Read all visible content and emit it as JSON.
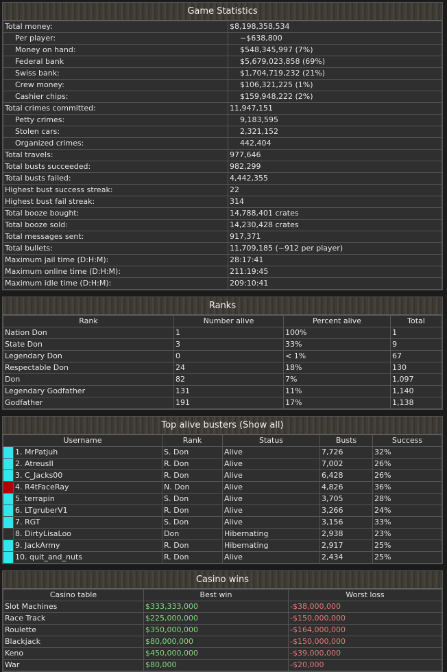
{
  "stats": {
    "title": "Game Statistics",
    "rows": [
      {
        "label": "Total money:",
        "value": "$8,198,358,534",
        "indent": false
      },
      {
        "label": "Per player:",
        "value": "~$638,800",
        "indent": true
      },
      {
        "label": "Money on hand:",
        "value": "$548,345,997 (7%)",
        "indent": true
      },
      {
        "label": "Federal bank",
        "value": "$5,679,023,858 (69%)",
        "indent": true
      },
      {
        "label": "Swiss bank:",
        "value": "$1,704,719,232 (21%)",
        "indent": true
      },
      {
        "label": "Crew money:",
        "value": "$106,321,225 (1%)",
        "indent": true
      },
      {
        "label": "Cashier chips:",
        "value": "$159,948,222 (2%)",
        "indent": true
      },
      {
        "label": "Total crimes committed:",
        "value": "11,947,151",
        "indent": false
      },
      {
        "label": "Petty crimes:",
        "value": "9,183,595",
        "indent": true
      },
      {
        "label": "Stolen cars:",
        "value": "2,321,152",
        "indent": true
      },
      {
        "label": "Organized crimes:",
        "value": "442,404",
        "indent": true
      },
      {
        "label": "Total travels:",
        "value": "977,646",
        "indent": false
      },
      {
        "label": "Total busts succeeded:",
        "value": "982,299",
        "indent": false
      },
      {
        "label": "Total busts failed:",
        "value": "4,442,355",
        "indent": false
      },
      {
        "label": "Highest bust success streak:",
        "value": "22",
        "indent": false
      },
      {
        "label": "Highest bust fail streak:",
        "value": "314",
        "indent": false
      },
      {
        "label": "Total booze bought:",
        "value": "14,788,401 crates",
        "indent": false
      },
      {
        "label": "Total booze sold:",
        "value": "14,230,428 crates",
        "indent": false
      },
      {
        "label": "Total messages sent:",
        "value": "917,371",
        "indent": false
      },
      {
        "label": "Total bullets:",
        "value": "11,709,185 (~912 per player)",
        "indent": false
      },
      {
        "label": "Maximum jail time (D:H:M):",
        "value": "28:17:41",
        "indent": false
      },
      {
        "label": "Maximum online time (D:H:M):",
        "value": "211:19:45",
        "indent": false
      },
      {
        "label": "Maximum idle time (D:H:M):",
        "value": "209:10:41",
        "indent": false
      }
    ]
  },
  "ranks": {
    "title": "Ranks",
    "columns": [
      "Rank",
      "Number alive",
      "Percent alive",
      "Total"
    ],
    "rows": [
      [
        "Nation Don",
        "1",
        "100%",
        "1"
      ],
      [
        "State Don",
        "3",
        "33%",
        "9"
      ],
      [
        "Legendary Don",
        "0",
        "< 1%",
        "67"
      ],
      [
        "Respectable Don",
        "24",
        "18%",
        "130"
      ],
      [
        "Don",
        "82",
        "7%",
        "1,097"
      ],
      [
        "Legendary Godfather",
        "131",
        "11%",
        "1,140"
      ],
      [
        "Godfather",
        "191",
        "17%",
        "1,138"
      ]
    ]
  },
  "busters": {
    "title": "Top alive busters (Show all)",
    "columns": [
      "Username",
      "Rank",
      "Status",
      "Busts",
      "Success"
    ],
    "colors": {
      "cyan": "#33e6ee",
      "red": "#b00000"
    },
    "rows": [
      {
        "marker": "cyan",
        "name": "1. MrPatjuh",
        "rank": "S. Don",
        "status": "Alive",
        "busts": "7,726",
        "success": "32%"
      },
      {
        "marker": "cyan",
        "name": "2. AtreusII",
        "rank": "R. Don",
        "status": "Alive",
        "busts": "7,002",
        "success": "26%"
      },
      {
        "marker": "cyan",
        "name": "3. C_Jacks00",
        "rank": "R. Don",
        "status": "Alive",
        "busts": "6,428",
        "success": "26%"
      },
      {
        "marker": "red",
        "name": "4. R4tFaceRay",
        "rank": "N. Don",
        "status": "Alive",
        "busts": "4,826",
        "success": "36%"
      },
      {
        "marker": "cyan",
        "name": "5. terrapin",
        "rank": "S. Don",
        "status": "Alive",
        "busts": "3,705",
        "success": "28%"
      },
      {
        "marker": "cyan",
        "name": "6. LTgruberV1",
        "rank": "R. Don",
        "status": "Alive",
        "busts": "3,266",
        "success": "24%"
      },
      {
        "marker": "cyan",
        "name": "7. RGT",
        "rank": "S. Don",
        "status": "Alive",
        "busts": "3,156",
        "success": "33%"
      },
      {
        "marker": "none",
        "name": "8. DirtyLisaLoo",
        "rank": "Don",
        "status": "Hibernating",
        "busts": "2,938",
        "success": "23%"
      },
      {
        "marker": "cyan",
        "name": "9. JackArmy",
        "rank": "R. Don",
        "status": "Hibernating",
        "busts": "2,917",
        "success": "25%"
      },
      {
        "marker": "cyan",
        "name": "10. quit_and_nuts",
        "rank": "R. Don",
        "status": "Alive",
        "busts": "2,434",
        "success": "25%"
      }
    ]
  },
  "casino": {
    "title": "Casino wins",
    "columns": [
      "Casino table",
      "Best win",
      "Worst loss"
    ],
    "colors": {
      "win": "#7fdc7f",
      "loss": "#e87878"
    },
    "rows": [
      [
        "Slot Machines",
        "$333,333,000",
        "-$38,000,000"
      ],
      [
        "Race Track",
        "$225,000,000",
        "-$150,000,000"
      ],
      [
        "Roulette",
        "$350,000,000",
        "-$164,000,000"
      ],
      [
        "Blackjack",
        "$80,000,000",
        "-$150,000,000"
      ],
      [
        "Keno",
        "$450,000,000",
        "-$39,000,000"
      ],
      [
        "War",
        "$80,000",
        "-$20,000"
      ]
    ]
  }
}
